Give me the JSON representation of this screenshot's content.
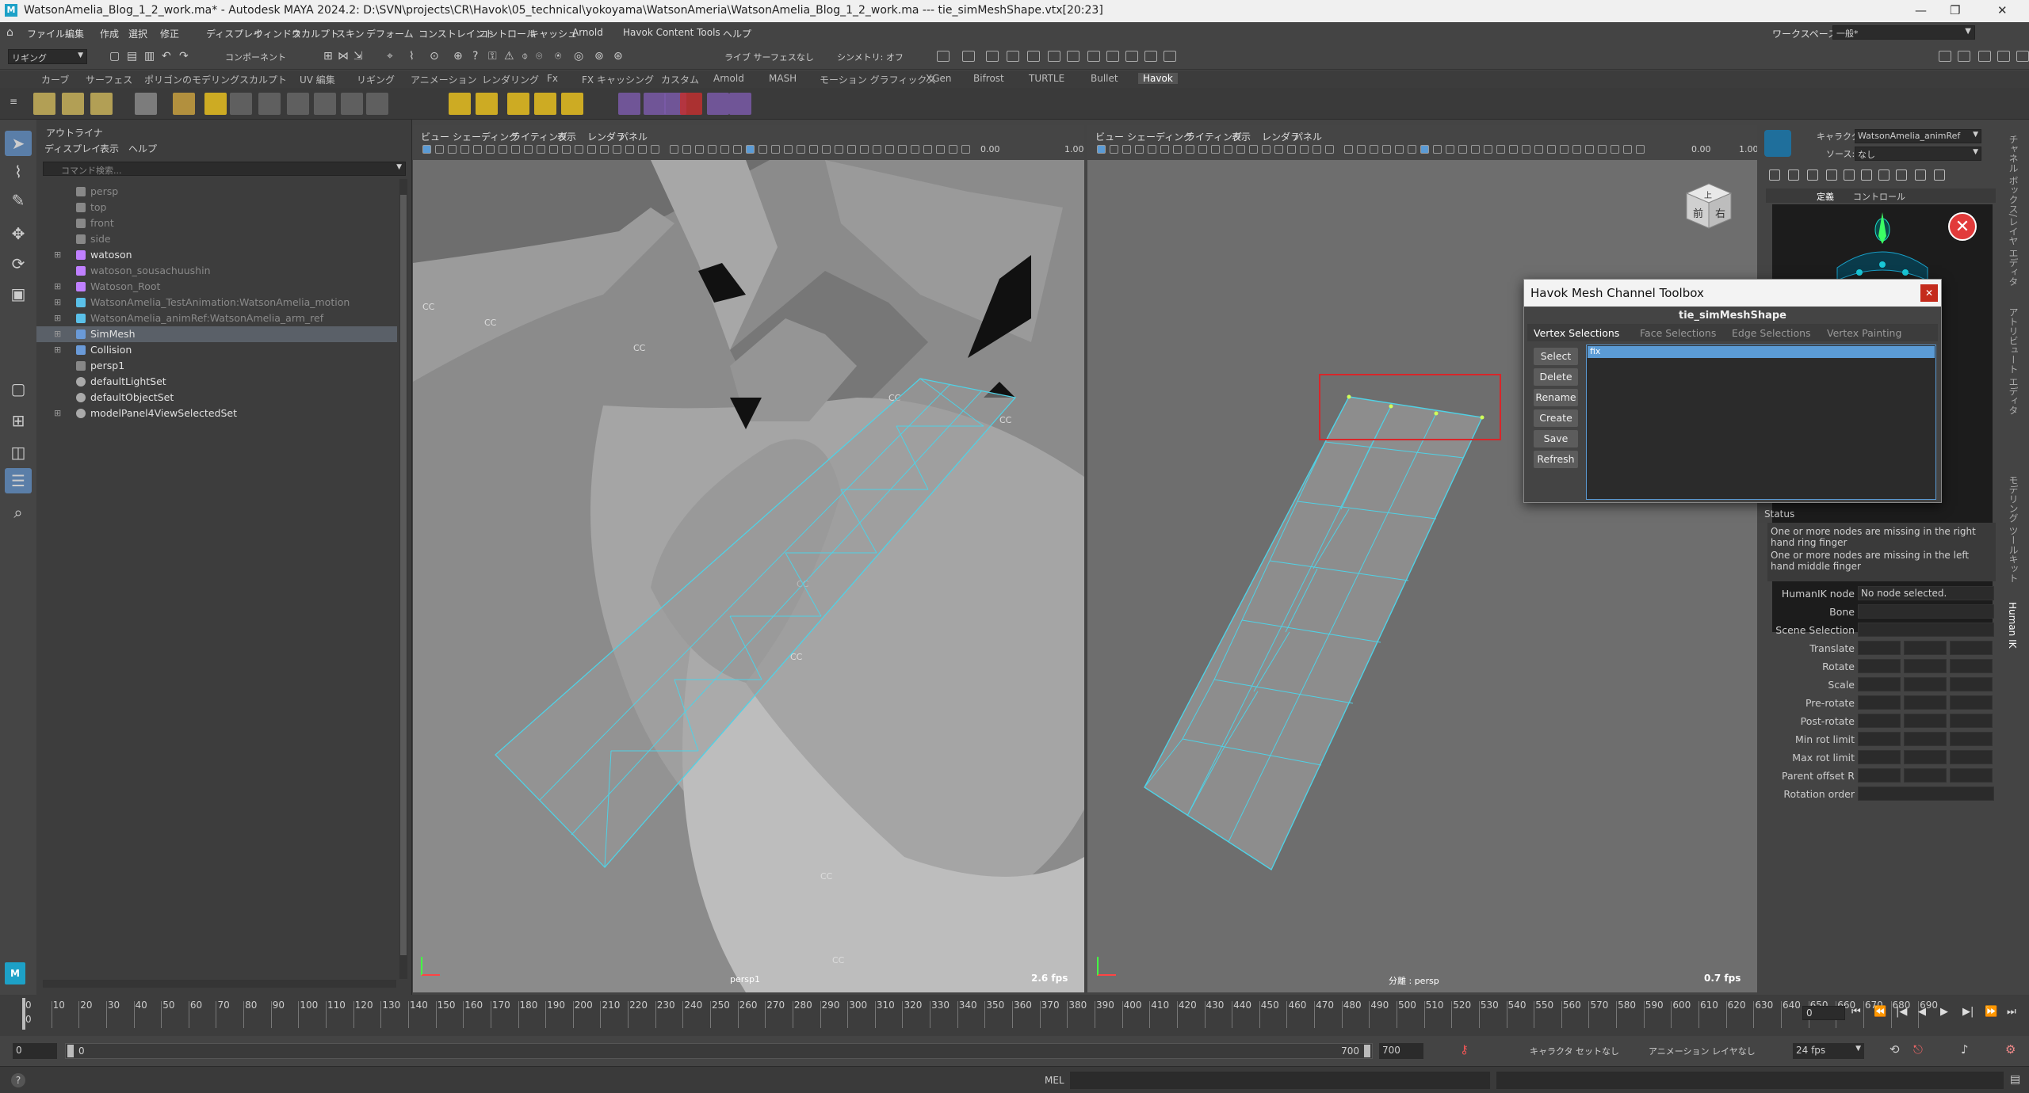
{
  "window": {
    "title": "WatsonAmelia_Blog_1_2_work.ma* - Autodesk MAYA 2024.2: D:\\SVN\\projects\\CR\\Havok\\05_technical\\yokoyama\\WatsonAmeria\\WatsonAmelia_Blog_1_2_work.ma   ---   tie_simMeshShape.vtx[20:23]",
    "minimize": "—",
    "maximize": "❐",
    "close": "✕"
  },
  "menubar": {
    "items": [
      "ファイル",
      "編集",
      "作成",
      "選択",
      "修正",
      "ディスプレイ",
      "ウィンドウ",
      "スカルプト",
      "スキン",
      "デフォーム",
      "コンストレイント",
      "コントロール",
      "キャッシュ",
      "Arnold",
      "Havok Content Tools",
      "ヘルプ"
    ],
    "workspace_label": "ワークスペース:",
    "workspace_value": "一般*"
  },
  "statusline": {
    "mode": "リギング",
    "component": "コンポーネント",
    "symmetry": "シンメトリ: オフ",
    "live": "ライブ サーフェスなし"
  },
  "shelf": {
    "tabs": [
      "カーブ",
      "サーフェス",
      "ポリゴンのモデリング",
      "スカルプト",
      "UV 編集",
      "リギング",
      "アニメーション",
      "レンダリング",
      "Fx",
      "FX キャッシング",
      "カスタム",
      "Arnold",
      "MASH",
      "モーション グラフィックス",
      "XGen",
      "Bifrost",
      "TURTLE",
      "Bullet",
      "Havok"
    ],
    "active": "Havok"
  },
  "outliner": {
    "title": "アウトライナ",
    "menus": [
      "ディスプレイ",
      "表示",
      "ヘルプ"
    ],
    "search_placeholder": "コマンド検索...",
    "items": [
      {
        "label": "persp",
        "expand": "",
        "icon": "camera",
        "dim": true
      },
      {
        "label": "top",
        "expand": "",
        "icon": "camera",
        "dim": true
      },
      {
        "label": "front",
        "expand": "",
        "icon": "camera",
        "dim": true
      },
      {
        "label": "side",
        "expand": "",
        "icon": "camera",
        "dim": true
      },
      {
        "label": "watoson",
        "expand": "⊞",
        "icon": "joint",
        "dim": false
      },
      {
        "label": "watoson_sousachuushin",
        "expand": "",
        "icon": "joint",
        "dim": true
      },
      {
        "label": "Watoson_Root",
        "expand": "⊞",
        "icon": "joint",
        "dim": true
      },
      {
        "label": "WatsonAmelia_TestAnimation:WatsonAmelia_motion",
        "expand": "⊞",
        "icon": "star",
        "dim": true
      },
      {
        "label": "WatsonAmelia_animRef:WatsonAmelia_arm_ref",
        "expand": "⊞",
        "icon": "star",
        "dim": true
      },
      {
        "label": "SimMesh",
        "expand": "⊞",
        "icon": "mesh",
        "dim": false,
        "selected": true
      },
      {
        "label": "Collision",
        "expand": "⊞",
        "icon": "mesh",
        "dim": false
      },
      {
        "label": "persp1",
        "expand": "",
        "icon": "camera",
        "dim": false
      },
      {
        "label": "defaultLightSet",
        "expand": "",
        "icon": "set",
        "dim": false
      },
      {
        "label": "defaultObjectSet",
        "expand": "",
        "icon": "set",
        "dim": false
      },
      {
        "label": "modelPanel4ViewSelectedSet",
        "expand": "⊞",
        "icon": "set",
        "dim": false
      }
    ]
  },
  "viewport_left": {
    "menus": [
      "ビュー",
      "シェーディング",
      "ライティング",
      "表示",
      "レンダラ",
      "パネル"
    ],
    "near": "0.00",
    "far": "1.00",
    "camera": "persp1",
    "fps": "2.6 fps",
    "cc_labels": [
      "CC",
      "CC",
      "CC",
      "CC",
      "CC",
      "CC",
      "CC",
      "CC",
      "CC"
    ]
  },
  "viewport_right": {
    "menus": [
      "ビュー",
      "シェーディング",
      "ライティング",
      "表示",
      "レンダラ",
      "パネル"
    ],
    "near": "0.00",
    "far": "1.00",
    "camera": "persp",
    "camera_prefix": "分離 :",
    "fps": "0.7 fps",
    "cube_front": "前",
    "cube_right": "右",
    "cube_top": "上"
  },
  "havok": {
    "title": "Havok Mesh Channel Toolbox",
    "subtitle": "tie_simMeshShape",
    "tabs": [
      "Vertex Selections",
      "Face Selections",
      "Edge Selections",
      "Vertex Painting"
    ],
    "active_tab": "Vertex Selections",
    "buttons": [
      "Select",
      "Delete",
      "Rename",
      "Create",
      "Save",
      "Refresh"
    ],
    "list": [
      "fix"
    ]
  },
  "humanik": {
    "character_label": "キャラクタ:",
    "character_value": "WatsonAmelia_animRef",
    "source_label": "ソース:",
    "source_value": "なし",
    "tabs": [
      "定義",
      "コントロール"
    ],
    "status_title": "Status",
    "status_lines": [
      "One or more nodes are missing in the right hand ring finger",
      "One or more nodes are missing in the left hand middle finger"
    ],
    "node_label": "HumanIK node",
    "node_value": "No node selected.",
    "rows": [
      "Bone",
      "Scene Selection",
      "Translate",
      "Rotate",
      "Scale",
      "Pre-rotate",
      "Post-rotate",
      "Min rot limit",
      "Max rot limit",
      "Parent offset R",
      "Rotation order"
    ],
    "side_tabs": [
      "チャネル ボックス/レイヤ エディタ",
      "アトリビュート エディタ",
      "モデリング ツールキット",
      "Human IK"
    ]
  },
  "timeline": {
    "ticks": [
      "0",
      "10",
      "20",
      "30",
      "40",
      "50",
      "60",
      "70",
      "80",
      "90",
      "100",
      "110",
      "120",
      "130",
      "140",
      "150",
      "160",
      "170",
      "180",
      "190",
      "200",
      "210",
      "220",
      "230",
      "240",
      "250",
      "260",
      "270",
      "280",
      "290",
      "300",
      "310",
      "320",
      "330",
      "340",
      "350",
      "360",
      "370",
      "380",
      "390",
      "400",
      "410",
      "420",
      "430",
      "440",
      "450",
      "460",
      "470",
      "480",
      "490",
      "500",
      "510",
      "520",
      "530",
      "540",
      "550",
      "560",
      "570",
      "580",
      "590",
      "600",
      "610",
      "620",
      "630",
      "640",
      "650",
      "660",
      "670",
      "680",
      "690"
    ],
    "current_left": "0",
    "current_frame": "0"
  },
  "range": {
    "start": "0",
    "inner_start": "0",
    "inner_end": "700",
    "end": "700",
    "character_set": "キャラクタ セットなし",
    "anim_layer": "アニメーション レイヤなし",
    "fps": "24 fps"
  },
  "cmdline": {
    "mel_label": "MEL",
    "help": "?"
  },
  "colors": {
    "accent": "#5b9bd5",
    "wire": "#4fd2e6",
    "selection_red": "#d8262a",
    "maya_blue": "#1da1c7"
  }
}
